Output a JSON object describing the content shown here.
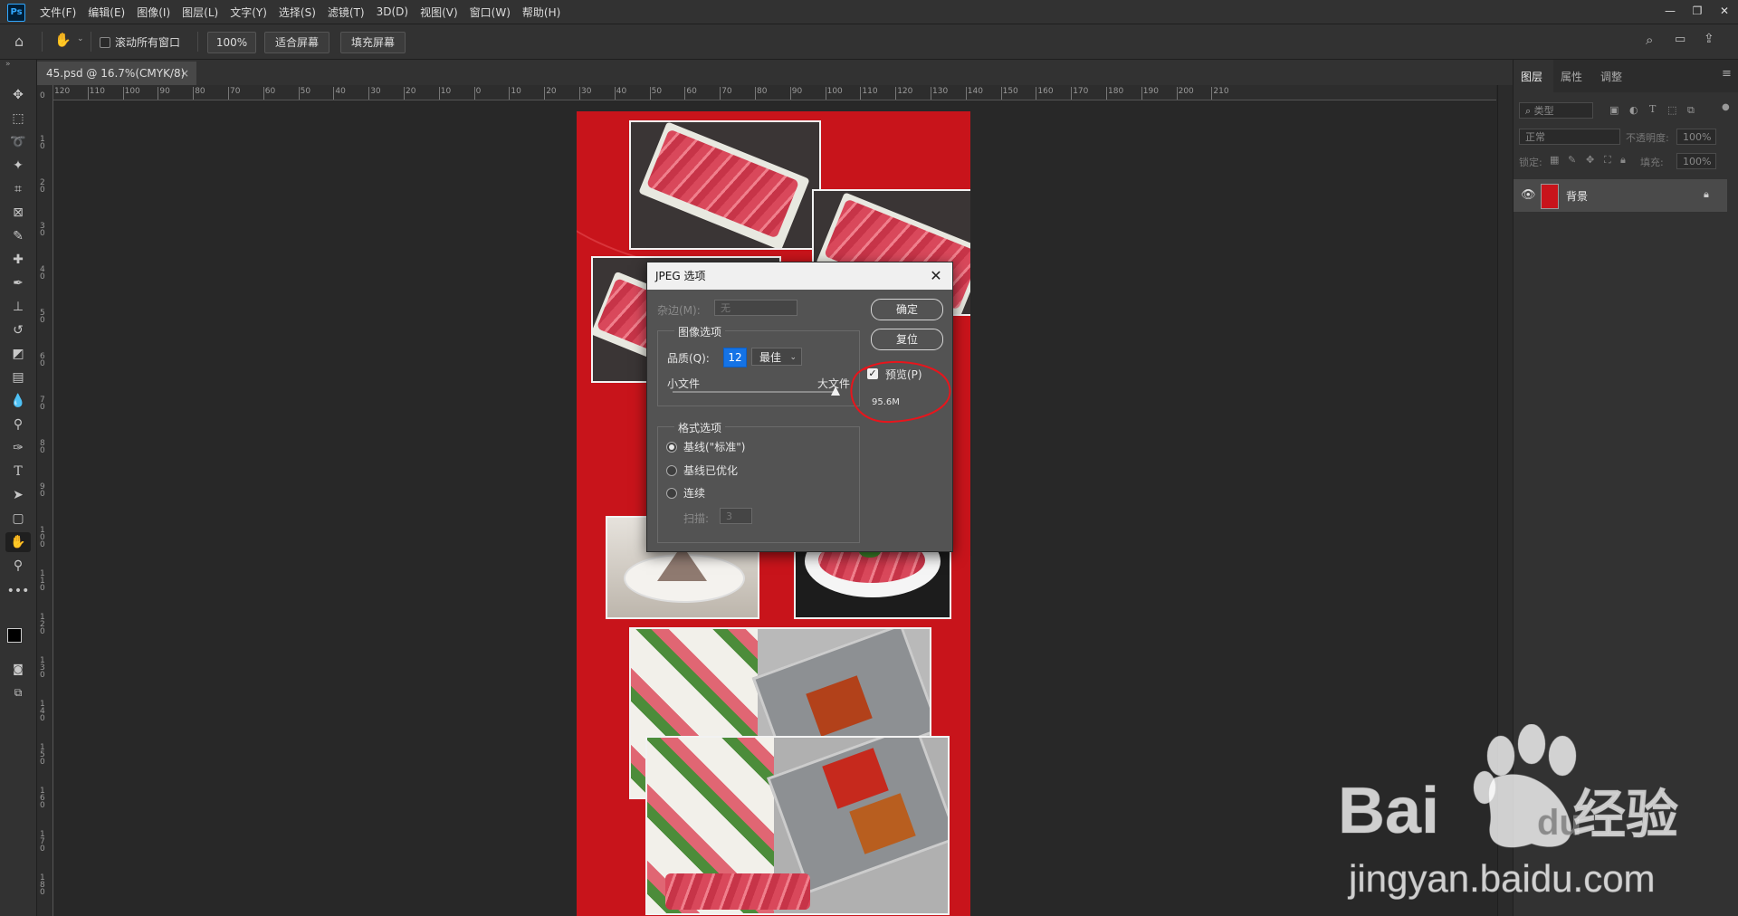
{
  "menubar": {
    "app_icon": "Ps",
    "items": [
      "文件(F)",
      "编辑(E)",
      "图像(I)",
      "图层(L)",
      "文字(Y)",
      "选择(S)",
      "滤镜(T)",
      "3D(D)",
      "视图(V)",
      "窗口(W)",
      "帮助(H)"
    ]
  },
  "optionsbar": {
    "scroll_all": "滚动所有窗口",
    "zoom": "100%",
    "fit_screen": "适合屏幕",
    "fill_screen": "填充屏幕"
  },
  "document": {
    "tab_title": "45.psd @ 16.7%(CMYK/8)",
    "close": "×"
  },
  "ruler": {
    "top_ticks": [
      "120",
      "110",
      "100",
      "90",
      "80",
      "70",
      "60",
      "50",
      "40",
      "30",
      "20",
      "10",
      "0",
      "10",
      "20",
      "30",
      "40",
      "50",
      "60",
      "70",
      "80",
      "90",
      "100",
      "110",
      "120",
      "130",
      "140",
      "150",
      "160",
      "170",
      "180",
      "190",
      "200",
      "210"
    ],
    "left_ticks": [
      "0",
      "1 0",
      "2 0",
      "3 0",
      "4 0",
      "5 0",
      "6 0",
      "7 0",
      "8 0",
      "9 0",
      "1 0 0",
      "1 1 0",
      "1 2 0",
      "1 3 0",
      "1 4 0",
      "1 5 0",
      "1 6 0",
      "1 7 0",
      "1 8 0"
    ]
  },
  "panel": {
    "tabs": [
      "图层",
      "属性",
      "调整"
    ],
    "filter_kind": "类型",
    "blend_mode": "正常",
    "opacity_label": "不透明度:",
    "opacity_value": "100%",
    "lock_label": "锁定:",
    "fill_label": "填充:",
    "fill_value": "100%",
    "layer_name": "背景"
  },
  "dialog": {
    "title": "JPEG 选项",
    "close": "✕",
    "matte_label": "杂边(M):",
    "matte_value": "无",
    "image_options_legend": "图像选项",
    "quality_label": "品质(Q):",
    "quality_value": "12",
    "quality_preset": "最佳",
    "small_file": "小文件",
    "large_file": "大文件",
    "format_legend": "格式选项",
    "format_options": [
      "基线(\"标准\")",
      "基线已优化",
      "连续"
    ],
    "scans_label": "扫描:",
    "scans_value": "3",
    "ok_button": "确定",
    "reset_button": "复位",
    "preview_label": "预览(P)",
    "file_size": "95.6M",
    "preview_checked": true,
    "selected_format_index": 0
  },
  "watermark": {
    "brand": "Bai",
    "brand2": "du",
    "cn": "经验",
    "url": "jingyan.baidu.com"
  },
  "colors": {
    "annotation_red": "#e8151c",
    "poster_red": "#c8141b",
    "accent_blue": "#1473e6"
  }
}
